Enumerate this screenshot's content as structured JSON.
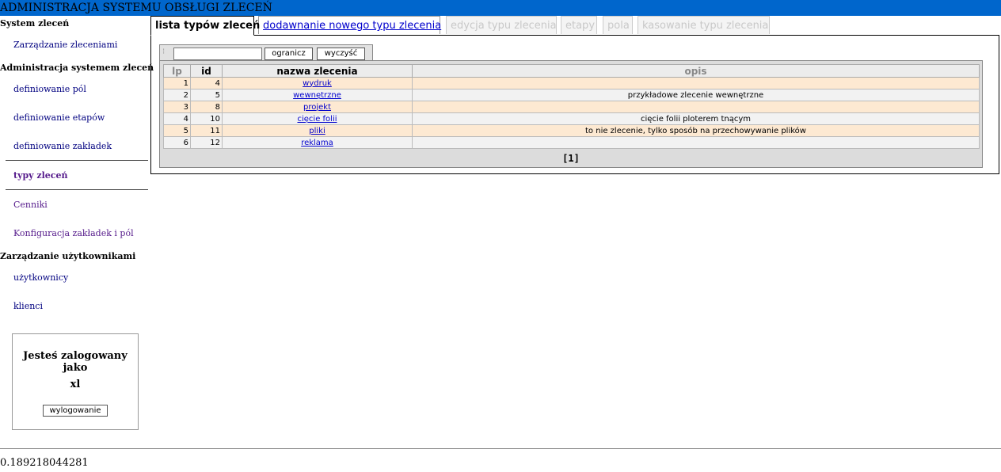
{
  "header": {
    "title": "ADMINISTRACJA SYSTEMU OBSŁUGI ZLECEŃ"
  },
  "sidebar": {
    "section1": "System zleceń",
    "link_zarzadzanie": "Zarządzanie zleceniami",
    "section2": "Administracja systemem zleceń",
    "link_pola": "definiowanie pól",
    "link_etapy": "definiowanie etapów",
    "link_zakladki": "definiowanie zakładek",
    "link_typy": "typy zleceń",
    "link_cenniki": "Cenniki",
    "link_konfig": "Konfiguracja zakładek i pól",
    "section3": "Zarządzanie użytkownikami",
    "link_uzytkownicy": "użytkownicy",
    "link_klienci": "klienci"
  },
  "login": {
    "title": "Jesteś zalogowany jako",
    "user": "xl",
    "logout_label": "wylogowanie"
  },
  "tabs": {
    "lista": "lista typów zleceń",
    "dodawanie": "dodawnanie nowego typu zlecenia",
    "edycja": "edycja typu zlecenia",
    "etapy": "etapy",
    "pola": "pola",
    "kasowanie": "kasowanie typu zlecenia"
  },
  "filter": {
    "value": "",
    "ogranicz": "ogranicz",
    "wyczysc": "wyczyść"
  },
  "table": {
    "headers": {
      "lp": "lp",
      "id": "id",
      "nazwa": "nazwa zlecenia",
      "opis": "opis"
    },
    "rows": [
      {
        "lp": "1",
        "id": "4",
        "nazwa": "wydruk",
        "opis": ""
      },
      {
        "lp": "2",
        "id": "5",
        "nazwa": "wewnętrzne",
        "opis": "przykładowe zlecenie wewnętrzne"
      },
      {
        "lp": "3",
        "id": "8",
        "nazwa": "projekt",
        "opis": ""
      },
      {
        "lp": "4",
        "id": "10",
        "nazwa": "cięcie folii",
        "opis": "cięcie folii ploterem tnącym"
      },
      {
        "lp": "5",
        "id": "11",
        "nazwa": "pliki",
        "opis": "to nie zlecenie, tylko sposób na przechowywanie plików"
      },
      {
        "lp": "6",
        "id": "12",
        "nazwa": "reklama",
        "opis": ""
      }
    ],
    "pager": "[1]"
  },
  "footer": {
    "value": "0.189218044281"
  }
}
